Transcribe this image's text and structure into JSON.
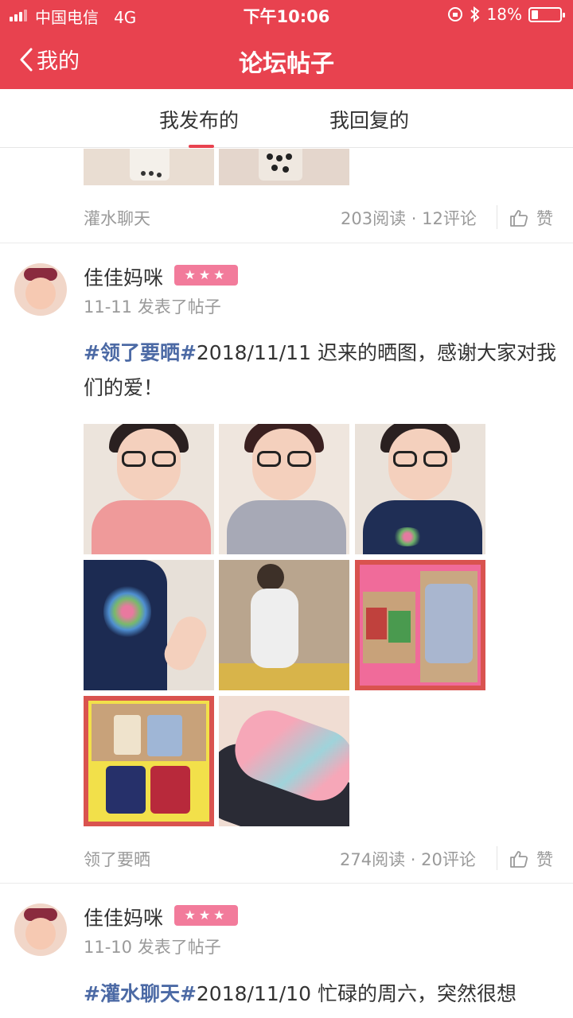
{
  "status_bar": {
    "carrier": "中国电信",
    "network": "4G",
    "time": "下午10:06",
    "battery": "18%"
  },
  "nav": {
    "back_label": "我的",
    "title": "论坛帖子"
  },
  "tabs": [
    {
      "label": "我发布的",
      "active": true
    },
    {
      "label": "我回复的",
      "active": false
    }
  ],
  "accent_color": "#e8424f",
  "tag_color": "#4c6aa5",
  "posts": [
    {
      "category": "灌水聊天",
      "stats": "203阅读 · 12评论",
      "like_label": "赞"
    },
    {
      "username": "佳佳妈咪",
      "badge": "★★★",
      "meta": "11-11 发表了帖子",
      "tag": "#领了要晒#",
      "text": "2018/11/11 迟来的晒图，感谢大家对我们的爱！",
      "category": "领了要晒",
      "stats": "274阅读 · 20评论",
      "like_label": "赞"
    },
    {
      "username": "佳佳妈咪",
      "badge": "★★★",
      "meta": "11-10 发表了帖子",
      "tag": "#灌水聊天#",
      "text": "2018/11/10 忙碌的周六，突然很想"
    }
  ]
}
